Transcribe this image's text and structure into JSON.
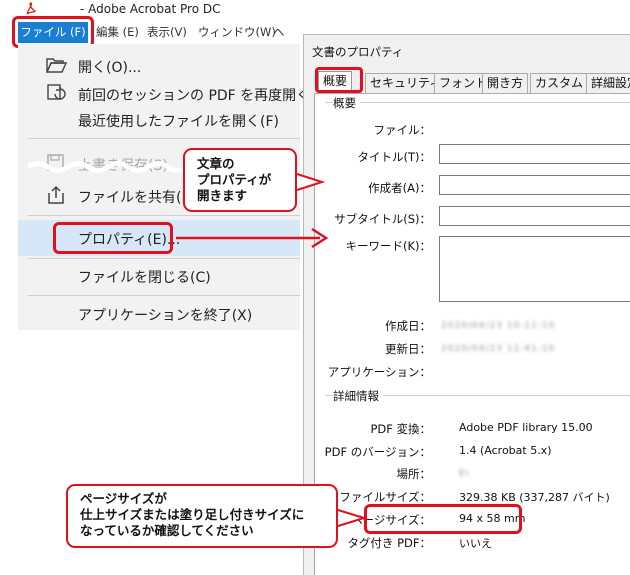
{
  "app": {
    "title": "- Adobe Acrobat Pro DC",
    "icon": "acrobat-icon"
  },
  "menubar": {
    "file": "ファイル (F)",
    "edit": "編集 (E)",
    "view": "表示(V)",
    "window": "ウィンドウ(W)",
    "help": "ヘ"
  },
  "file_menu": {
    "open": "開く(O)...",
    "reopen": "前回のセッションの PDF を再度開く",
    "recent": "最近使用したファイルを開く(F)",
    "save_disabled": "上書き保存(S)",
    "share": "ファイルを共有(L)",
    "properties": "プロパティ(E)...",
    "close": "ファイルを閉じる(C)",
    "exit": "アプリケーションを終了(X)"
  },
  "callouts": {
    "properties_open": [
      "文章の",
      "プロパティが",
      "開きます"
    ],
    "page_size_note": [
      "ページサイズが",
      "仕上サイズまたは塗り足し付きサイズに",
      "なっているか確認してください"
    ]
  },
  "dialog": {
    "title": "文書のプロパティ",
    "tabs": [
      "概要",
      "セキュリティ",
      "フォント",
      "開き方",
      "カスタム",
      "詳細設定"
    ],
    "summary_group": "概要",
    "labels": {
      "file": "ファイル：",
      "title": "タイトル(T)：",
      "author": "作成者(A)：",
      "subject": "サブタイトル(S)：",
      "keywords": "キーワード(K)：",
      "created": "作成日：",
      "modified": "更新日：",
      "application": "アプリケーション："
    },
    "blurred": {
      "created": "2020/04/23 10:11:10",
      "modified": "2020/04/23 11:41:10"
    },
    "detail_group": "詳細情報",
    "details": {
      "producer_label": "PDF 変換：",
      "producer": "Adobe PDF library 15.00",
      "version_label": "PDF のバージョン：",
      "version": "1.4 (Acrobat 5.x)",
      "location_label": "場所：",
      "location_blur": "E\\",
      "filesize_label": "ファイルサイズ：",
      "filesize": "329.38 KB (337,287 バイト)",
      "pagesize_label": "ページサイズ：",
      "pagesize": "94 x 58 mm",
      "tagged_label": "タグ付き PDF：",
      "tagged": "いいえ"
    }
  },
  "colors": {
    "highlight_red": "#e0101c",
    "menu_blue": "#1a7fd3",
    "selected_row": "#d6e8f8"
  }
}
